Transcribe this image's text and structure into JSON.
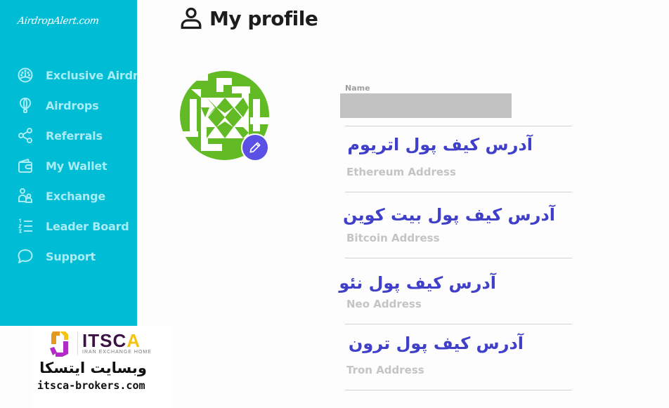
{
  "sidebar": {
    "logo": "AirdropAlert.com",
    "items": [
      {
        "label": "Exclusive Airdrops",
        "icon": "dashboard-icon"
      },
      {
        "label": "Airdrops",
        "icon": "balloon-icon"
      },
      {
        "label": "Referrals",
        "icon": "share-icon"
      },
      {
        "label": "My Wallet",
        "icon": "wallet-icon"
      },
      {
        "label": "Exchange",
        "icon": "exchange-users-icon"
      },
      {
        "label": "Leader Board",
        "icon": "ordered-list-icon"
      },
      {
        "label": "Support",
        "icon": "chat-bubble-icon"
      }
    ]
  },
  "header": {
    "title": "My profile",
    "icon": "user-icon"
  },
  "profile": {
    "avatar": "identicon-avatar",
    "edit_icon": "pencil-icon",
    "name_label": "Name",
    "name_value": ""
  },
  "fields": [
    {
      "annotation_fa": "آدرس کیف پول اتریوم",
      "placeholder": "Ethereum Address",
      "value": ""
    },
    {
      "annotation_fa": "آدرس کیف پول بیت کوین",
      "placeholder": "Bitcoin Address",
      "value": ""
    },
    {
      "annotation_fa": "آدرس کیف پول نئو",
      "placeholder": "Neo Address",
      "value": ""
    },
    {
      "annotation_fa": "آدرس کیف پول ترون",
      "placeholder": "Tron Address",
      "value": ""
    }
  ],
  "watermark": {
    "brand_main": "IT",
    "brand_rest": "SC",
    "brand_accent": "A",
    "tagline": "IRAN EXCHANGE HOME",
    "site_fa": "وبسایت ایتسکا",
    "url": "itsca-brokers.com"
  },
  "colors": {
    "sidebar_bg": "#00bcd4",
    "sidebar_text": "#a8ecf5",
    "accent_edit": "#5b50e6",
    "annotation": "#3f3fc9",
    "avatar_green": "#62bb25"
  }
}
